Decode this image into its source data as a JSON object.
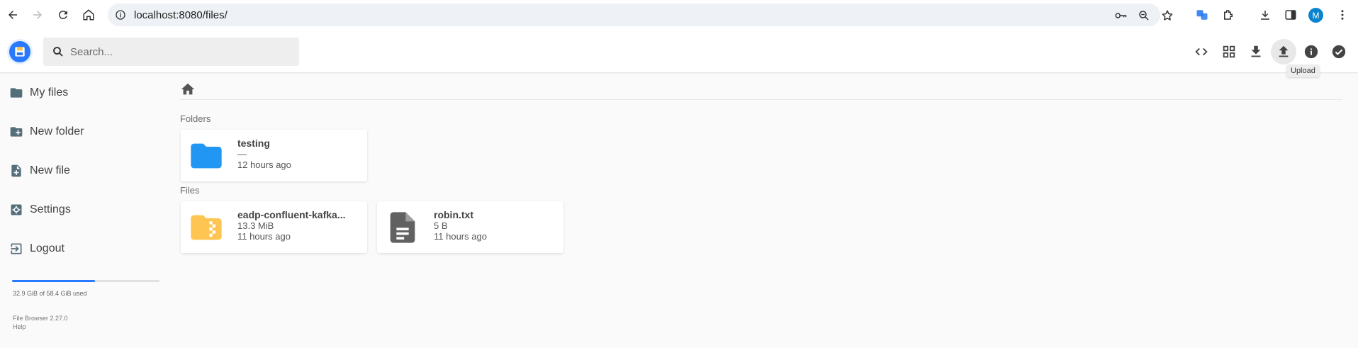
{
  "browser": {
    "url": "localhost:8080/files/",
    "profile_initial": "M"
  },
  "header": {
    "search_placeholder": "Search...",
    "tooltip": "Upload",
    "buttons": [
      "code-icon",
      "grid-view-icon",
      "download-icon",
      "upload-icon",
      "info-icon",
      "check-circle-icon"
    ]
  },
  "sidebar": {
    "items": [
      {
        "label": "My files",
        "icon": "folder-icon"
      },
      {
        "label": "New folder",
        "icon": "create-new-folder-icon"
      },
      {
        "label": "New file",
        "icon": "note-add-icon"
      },
      {
        "label": "Settings",
        "icon": "settings-icon"
      },
      {
        "label": "Logout",
        "icon": "exit-icon"
      }
    ],
    "usage": {
      "text": "32.9 GiB of 58.4 GiB used",
      "fraction": 0.563
    },
    "version": "File Browser 2.27.0",
    "help": "Help"
  },
  "main": {
    "folders_label": "Folders",
    "files_label": "Files",
    "folders": [
      {
        "name": "testing",
        "size": "—",
        "modified": "12 hours ago",
        "icon": "folder-icon"
      }
    ],
    "files": [
      {
        "name": "eadp-confluent-kafka...",
        "size": "13.3 MiB",
        "modified": "11 hours ago",
        "icon": "zip-folder-icon"
      },
      {
        "name": "robin.txt",
        "size": "5 B",
        "modified": "11 hours ago",
        "icon": "text-file-icon"
      }
    ]
  },
  "colors": {
    "accent": "#2979ff",
    "folder": "#2196f3",
    "zip": "#ffc552",
    "text_file": "#616161"
  }
}
